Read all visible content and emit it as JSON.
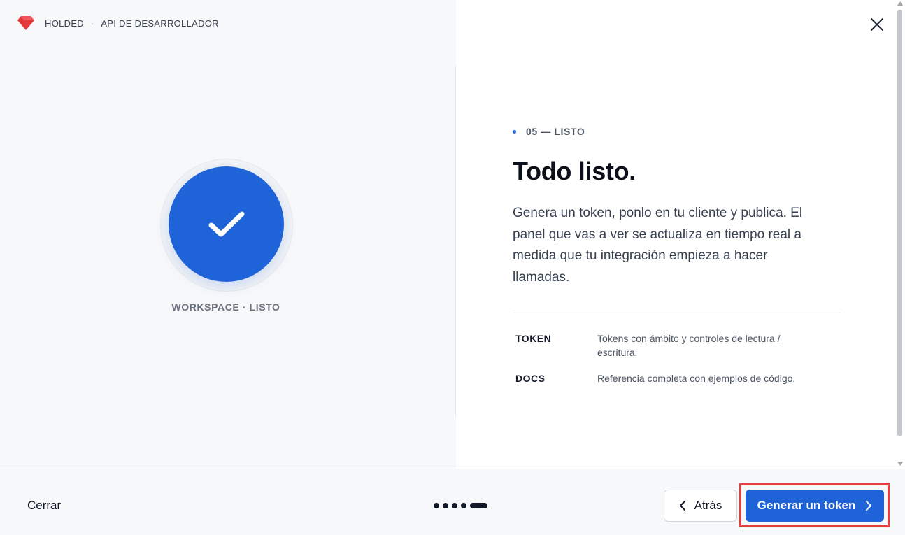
{
  "header": {
    "brand_name": "HOLDED",
    "separator": "·",
    "subtitle": "API DE DESARROLLADOR"
  },
  "hero": {
    "status_label": "WORKSPACE · LISTO"
  },
  "content": {
    "step_label": "05 — LISTO",
    "title": "Todo listo.",
    "description": "Genera un token, ponlo en tu cliente y publica. El panel que vas a ver se actualiza en tiempo real a medida que tu integración empieza a hacer llamadas.",
    "features": [
      {
        "key": "TOKEN",
        "value": "Tokens con ámbito y controles de lectura / escritura."
      },
      {
        "key": "DOCS",
        "value": "Referencia completa con ejemplos de código."
      }
    ]
  },
  "footer": {
    "close_label": "Cerrar",
    "back_label": "Atrás",
    "primary_label": "Generar un token",
    "steps_total": 5,
    "current_step": 5
  },
  "colors": {
    "accent": "#1f63d9",
    "brand": "#e5383b",
    "highlight": "#e53e3e"
  },
  "icons": {
    "logo": "holded-logo-icon",
    "close": "close-icon",
    "check": "check-icon",
    "back": "chevron-left-icon",
    "next": "chevron-right-icon"
  }
}
